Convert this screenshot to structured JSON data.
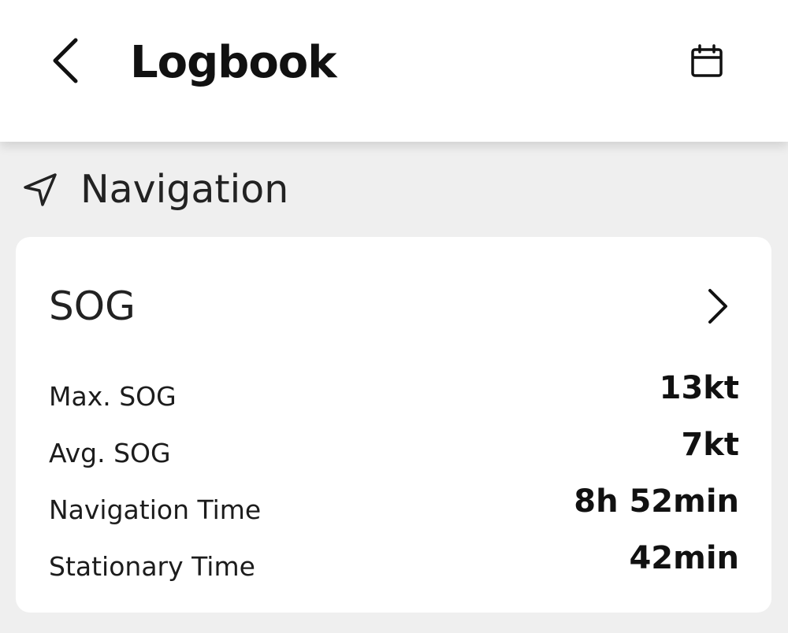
{
  "header": {
    "title": "Logbook",
    "back_icon": "chevron-left-icon",
    "calendar_icon": "calendar-icon"
  },
  "section": {
    "title": "Navigation",
    "icon": "navigation-arrow-icon"
  },
  "card": {
    "title": "SOG",
    "chevron_icon": "chevron-right-icon",
    "rows": [
      {
        "label": "Max. SOG",
        "value": "13kt"
      },
      {
        "label": "Avg. SOG",
        "value": "7kt"
      },
      {
        "label": "Navigation Time",
        "value": "8h 52min"
      },
      {
        "label": "Stationary Time",
        "value": "42min"
      }
    ]
  },
  "colors": {
    "background": "#efefef",
    "surface": "#ffffff",
    "text": "#1a1a1a"
  }
}
